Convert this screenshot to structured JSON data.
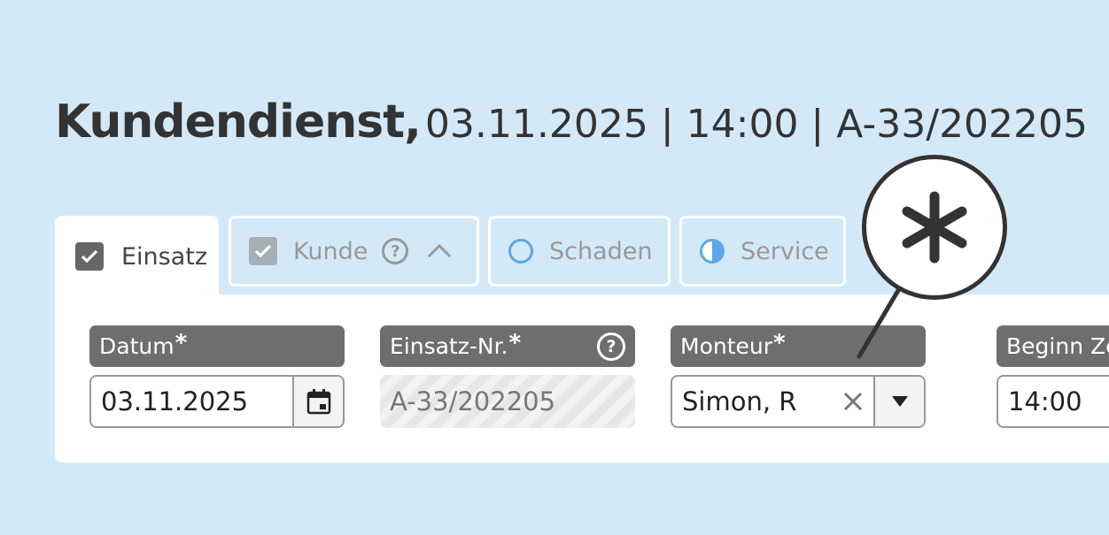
{
  "header": {
    "title": "Kundendienst,",
    "meta": "03.11.2025 | 14:00 | A-33/202205"
  },
  "tabs": [
    {
      "label": "Einsatz",
      "state": "checked",
      "icon": "checkbox-checked-icon"
    },
    {
      "label": "Kunde",
      "state": "checked-disabled",
      "icon": "checkbox-checked-icon"
    },
    {
      "label": "Schaden",
      "state": "empty",
      "icon": "empty-circle-icon"
    },
    {
      "label": "Service",
      "state": "half",
      "icon": "half-circle-icon"
    }
  ],
  "fields": {
    "datum": {
      "label": "Datum",
      "required": "*",
      "value": "03.11.2025",
      "icon": "calendar-icon"
    },
    "einsatz_nr": {
      "label": "Einsatz-Nr.",
      "required": "*",
      "value": "A-33/202205",
      "icon": "help-icon"
    },
    "monteur": {
      "label": "Monteur",
      "required": "*",
      "value": "Simon, R",
      "icons": [
        "clear-icon",
        "dropdown-arrow-icon"
      ]
    },
    "beginn": {
      "label": "Beginn Ze",
      "value": "14:00"
    }
  },
  "callout": {
    "symbol": "asterisk-icon",
    "meaning": "required-marker"
  },
  "colors": {
    "background": "#d4e9f8",
    "panel": "#ffffff",
    "label_bg": "#6e6e6e",
    "accent": "#5aa9e6",
    "text": "#333333"
  }
}
